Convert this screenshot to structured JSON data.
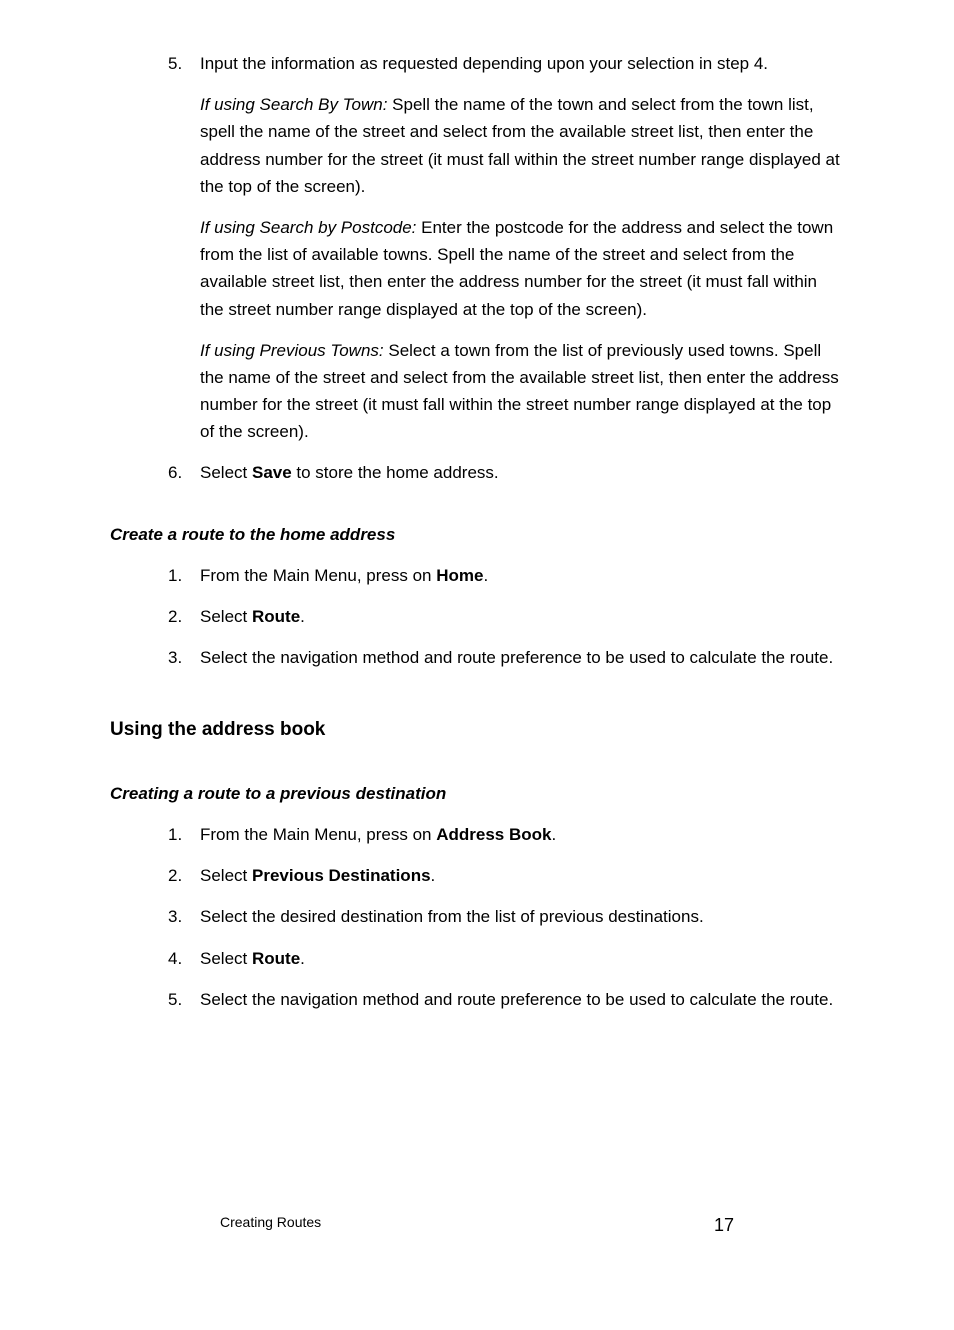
{
  "listA": {
    "item5": {
      "num": "5.",
      "intro": "Input the information as requested depending upon your selection in step 4.",
      "p1_label": "If using Search By Town:",
      "p1_text": " Spell the name of the town and select from the town list, spell the name of the street and select from the available street list, then enter the address number for the street (it must fall within the street number range displayed at the top of the screen).",
      "p2_label": "If using Search by Postcode:",
      "p2_text": " Enter the postcode for the address and select the town from the list of available towns. Spell the name of the street and select from the available street list, then enter the address number for the street (it must fall within the street number range displayed at the top of the screen).",
      "p3_label": "If using Previous Towns:",
      "p3_text": " Select a town from the list of previously used towns. Spell the name of the street and select from the available street list, then enter the address number for the street (it must fall within the street number range displayed at the top of the screen)."
    },
    "item6": {
      "num": "6.",
      "pre": "Select ",
      "bold": "Save",
      "post": " to store the home address."
    }
  },
  "sub1": {
    "heading": "Create a route to the home address",
    "s1": {
      "num": "1.",
      "pre": "From the Main Menu, press on ",
      "bold": "Home",
      "post": "."
    },
    "s2": {
      "num": "2.",
      "pre": "Select ",
      "bold": "Route",
      "post": "."
    },
    "s3": {
      "num": "3.",
      "text": "Select the navigation method and route preference to be used to calculate the route."
    }
  },
  "section2": {
    "heading": "Using the address book"
  },
  "sub2": {
    "heading": "Creating a route to a previous destination",
    "s1": {
      "num": "1.",
      "pre": "From the Main Menu, press on ",
      "bold": "Address Book",
      "post": "."
    },
    "s2": {
      "num": "2.",
      "pre": "Select ",
      "bold": "Previous Destinations",
      "post": "."
    },
    "s3": {
      "num": "3.",
      "text": "Select the desired destination from the list of previous destinations."
    },
    "s4": {
      "num": "4.",
      "pre": "Select ",
      "bold": "Route",
      "post": "."
    },
    "s5": {
      "num": "5.",
      "text": "Select the navigation method and route preference to be used to calculate the route."
    }
  },
  "footer": {
    "left": "Creating Routes",
    "right": "17"
  }
}
